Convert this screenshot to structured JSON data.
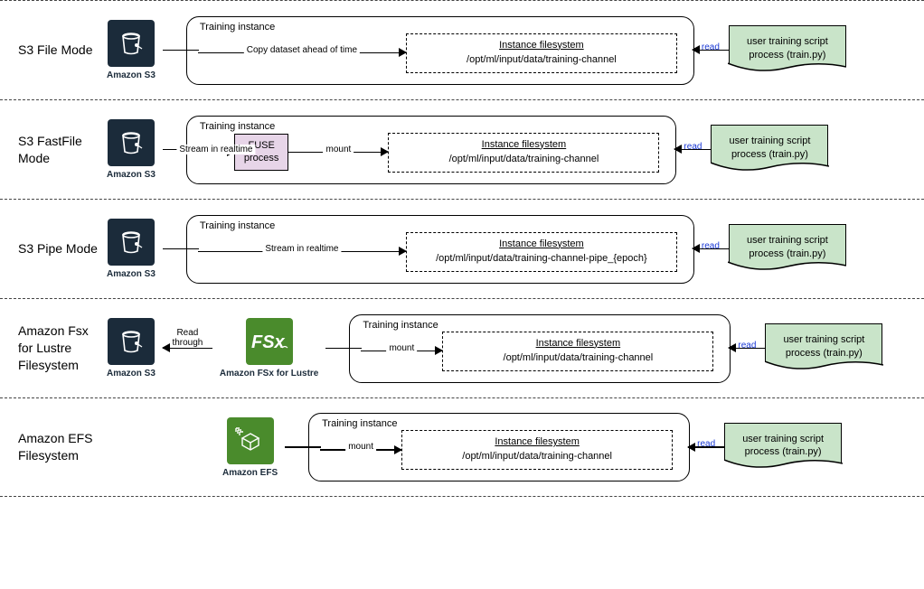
{
  "rows": [
    {
      "label": "S3 File Mode",
      "source_icon": "s3",
      "source_caption": "Amazon S3",
      "pre_service": null,
      "arrow_to_instance": "Copy dataset ahead of time",
      "fuse": false,
      "fuse_label": "",
      "mount_caption": "",
      "fs_title": "Instance filesystem",
      "fs_path": "/opt/ml/input/data/training-channel",
      "read_label": "read",
      "script1": "user training script",
      "script2": "process (train.py)"
    },
    {
      "label": "S3 FastFile Mode",
      "source_icon": "s3",
      "source_caption": "Amazon S3",
      "pre_service": null,
      "arrow_to_instance": "Stream in realtime",
      "fuse": true,
      "fuse_label": "FUSE\nprocess",
      "mount_caption": "mount",
      "fs_title": "Instance filesystem",
      "fs_path": "/opt/ml/input/data/training-channel",
      "read_label": "read",
      "script1": "user training script",
      "script2": "process (train.py)"
    },
    {
      "label": "S3 Pipe Mode",
      "source_icon": "s3",
      "source_caption": "Amazon S3",
      "pre_service": null,
      "arrow_to_instance": "Stream in realtime",
      "fuse": false,
      "fuse_label": "",
      "mount_caption": "",
      "fs_title": "Instance filesystem",
      "fs_path": "/opt/ml/input/data/training-channel-pipe_{epoch}",
      "read_label": "read",
      "script1": "user training script",
      "script2": "process (train.py)"
    },
    {
      "label": "Amazon Fsx for Lustre Filesystem",
      "source_icon": "s3",
      "source_caption": "Amazon S3",
      "pre_service": {
        "icon": "fsx",
        "caption": "Amazon FSx for Lustre",
        "back_arrow": "Read\nthrough"
      },
      "arrow_to_instance": "mount",
      "fuse": false,
      "fuse_label": "",
      "mount_caption": "",
      "fs_title": "Instance filesystem",
      "fs_path": "/opt/ml/input/data/training-channel",
      "read_label": "read",
      "script1": "user training script",
      "script2": "process (train.py)"
    },
    {
      "label": "Amazon EFS Filesystem",
      "source_icon": "efs",
      "source_caption": "Amazon EFS",
      "pre_service": null,
      "arrow_to_instance": "mount",
      "fuse": false,
      "fuse_label": "",
      "mount_caption": "",
      "fs_title": "Instance filesystem",
      "fs_path": "/opt/ml/input/data/training-channel",
      "read_label": "read",
      "script1": "user training script",
      "script2": "process (train.py)"
    }
  ],
  "training_instance_label": "Training instance"
}
